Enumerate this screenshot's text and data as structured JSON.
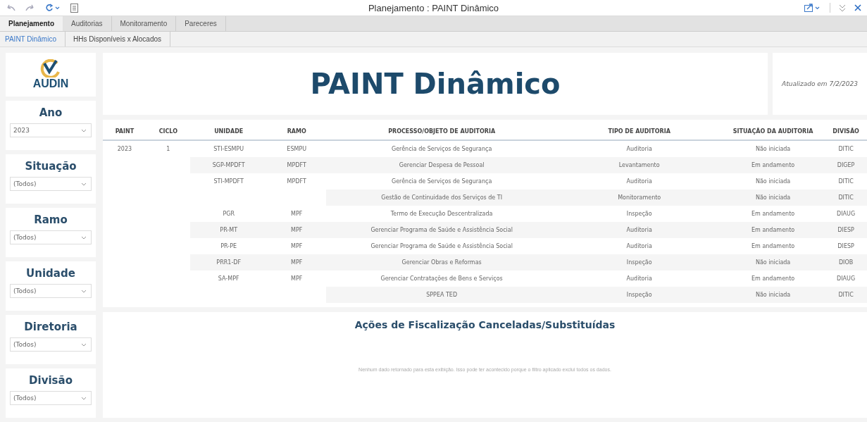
{
  "window": {
    "title": "Planejamento : PAINT Dinâmico"
  },
  "tabs": [
    {
      "label": "Planejamento",
      "selected": true
    },
    {
      "label": "Auditorias",
      "selected": false
    },
    {
      "label": "Monitoramento",
      "selected": false
    },
    {
      "label": "Pareceres",
      "selected": false
    }
  ],
  "subtabs": [
    {
      "label": "PAINT Dinâmico",
      "selected": true
    },
    {
      "label": "HHs Disponíveis x Alocados",
      "selected": false
    }
  ],
  "logo": {
    "text": "AUDIN"
  },
  "filters": [
    {
      "label": "Ano",
      "value": "2023"
    },
    {
      "label": "Situação",
      "value": "(Todos)"
    },
    {
      "label": "Ramo",
      "value": "(Todos)"
    },
    {
      "label": "Unidade",
      "value": "(Todos)"
    },
    {
      "label": "Diretoria",
      "value": "(Todos)"
    },
    {
      "label": "Divisão",
      "value": "(Todos)"
    }
  ],
  "header": {
    "title": "PAINT Dinâmico",
    "updated": "Atualizado em 7/2/2023"
  },
  "table": {
    "columns": [
      "PAINT",
      "CICLO",
      "UNIDADE",
      "RAMO",
      "PROCESSO/OBJETO DE AUDITORIA",
      "TIPO DE AUDITORIA",
      "SITUAÇÃO DA AUDITORIA",
      "DIVISÃO"
    ],
    "rows": [
      {
        "paint": "2023",
        "ciclo": "1",
        "unidade": "STI-ESMPU",
        "ramo": "ESMPU",
        "processo": "Gerência de Serviços de Segurança",
        "tipo": "Auditoria",
        "situacao": "Não iniciada",
        "divisao": "DITIC"
      },
      {
        "unidade": "SGP-MPDFT",
        "ramo": "MPDFT",
        "processo": "Gerenciar Despesa de Pessoal",
        "tipo": "Levantamento",
        "situacao": "Em andamento",
        "divisao": "DIGEP"
      },
      {
        "unidade": "STI-MPDFT",
        "ramo": "MPDFT",
        "processo": "Gerência de Serviços de Segurança",
        "tipo": "Auditoria",
        "situacao": "Não iniciada",
        "divisao": "DITIC"
      },
      {
        "processo": "Gestão de Continuidade dos Serviços de TI",
        "tipo": "Monitoramento",
        "situacao": "Não iniciada",
        "divisao": "DITIC"
      },
      {
        "unidade": "PGR",
        "ramo": "MPF",
        "processo": "Termo de Execução Descentralizada",
        "tipo": "Inspeção",
        "situacao": "Em andamento",
        "divisao": "DIAUG"
      },
      {
        "unidade": "PR-MT",
        "ramo": "MPF",
        "processo": "Gerenciar Programa de Saúde e Assistência Social",
        "tipo": "Auditoria",
        "situacao": "Em andamento",
        "divisao": "DIESP"
      },
      {
        "unidade": "PR-PE",
        "ramo": "MPF",
        "processo": "Gerenciar Programa de Saúde e Assistência Social",
        "tipo": "Auditoria",
        "situacao": "Em andamento",
        "divisao": "DIESP"
      },
      {
        "unidade": "PRR1-DF",
        "ramo": "MPF",
        "processo": "Gerenciar Obras e Reformas",
        "tipo": "Inspeção",
        "situacao": "Não iniciada",
        "divisao": "DIOB"
      },
      {
        "unidade": "SA-MPF",
        "ramo": "MPF",
        "processo": "Gerenciar Contratações de Bens e Serviços",
        "tipo": "Auditoria",
        "situacao": "Em andamento",
        "divisao": "DIAUG"
      },
      {
        "processo": "SPPEA TED",
        "tipo": "Inspeção",
        "situacao": "Não iniciada",
        "divisao": "DITIC"
      }
    ]
  },
  "cancelled": {
    "title": "Ações de Fiscalização Canceladas/Substituídas",
    "message": "Nenhum dado retornado para esta exibição. Isso pode ter acontecido porque o filtro aplicado exclui todos os dados."
  }
}
